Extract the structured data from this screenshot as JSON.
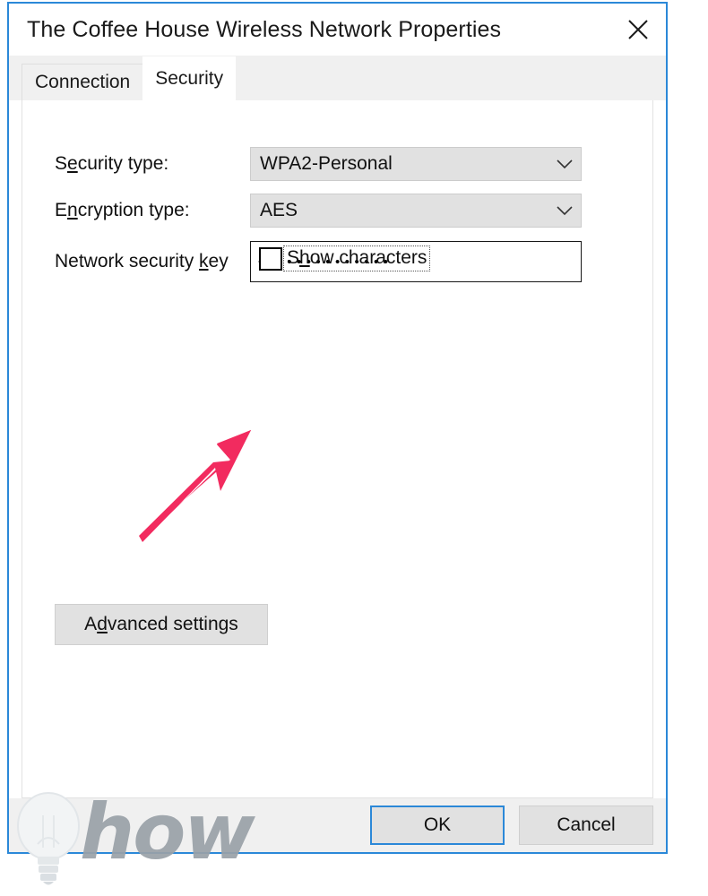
{
  "window": {
    "title": "The Coffee House Wireless Network Properties",
    "close_icon": "close-icon",
    "border_color": "#2b88d8"
  },
  "tabs": [
    {
      "label": "Connection",
      "active": false
    },
    {
      "label": "Security",
      "active": true
    }
  ],
  "form": {
    "security_type": {
      "label_before": "S",
      "label_accel": "e",
      "label_after": "curity type:",
      "value": "WPA2-Personal",
      "chevron_icon": "chevron-down-icon"
    },
    "encryption_type": {
      "label_before": "E",
      "label_accel": "n",
      "label_after": "cryption type:",
      "value": "AES",
      "chevron_icon": "chevron-down-icon"
    },
    "network_security_key": {
      "label_before": "Network security ",
      "label_accel": "k",
      "label_after": "ey",
      "value": "••••••••••••••",
      "masked": true,
      "char_count": 14
    },
    "show_characters": {
      "label_before": "S",
      "label_accel": "h",
      "label_after": "ow characters",
      "checked": false,
      "focused": true
    }
  },
  "buttons": {
    "advanced_settings": {
      "label_before": "A",
      "label_accel": "d",
      "label_after": "vanced settings"
    },
    "ok": "OK",
    "cancel": "Cancel"
  },
  "annotation": {
    "arrow_color": "#f22b5f",
    "arrow_icon": "arrow-up-right-icon",
    "points_to": "show-characters-checkbox"
  },
  "watermark": {
    "text": "how",
    "icon": "lightbulb-icon",
    "color": "#9aa1a8"
  }
}
